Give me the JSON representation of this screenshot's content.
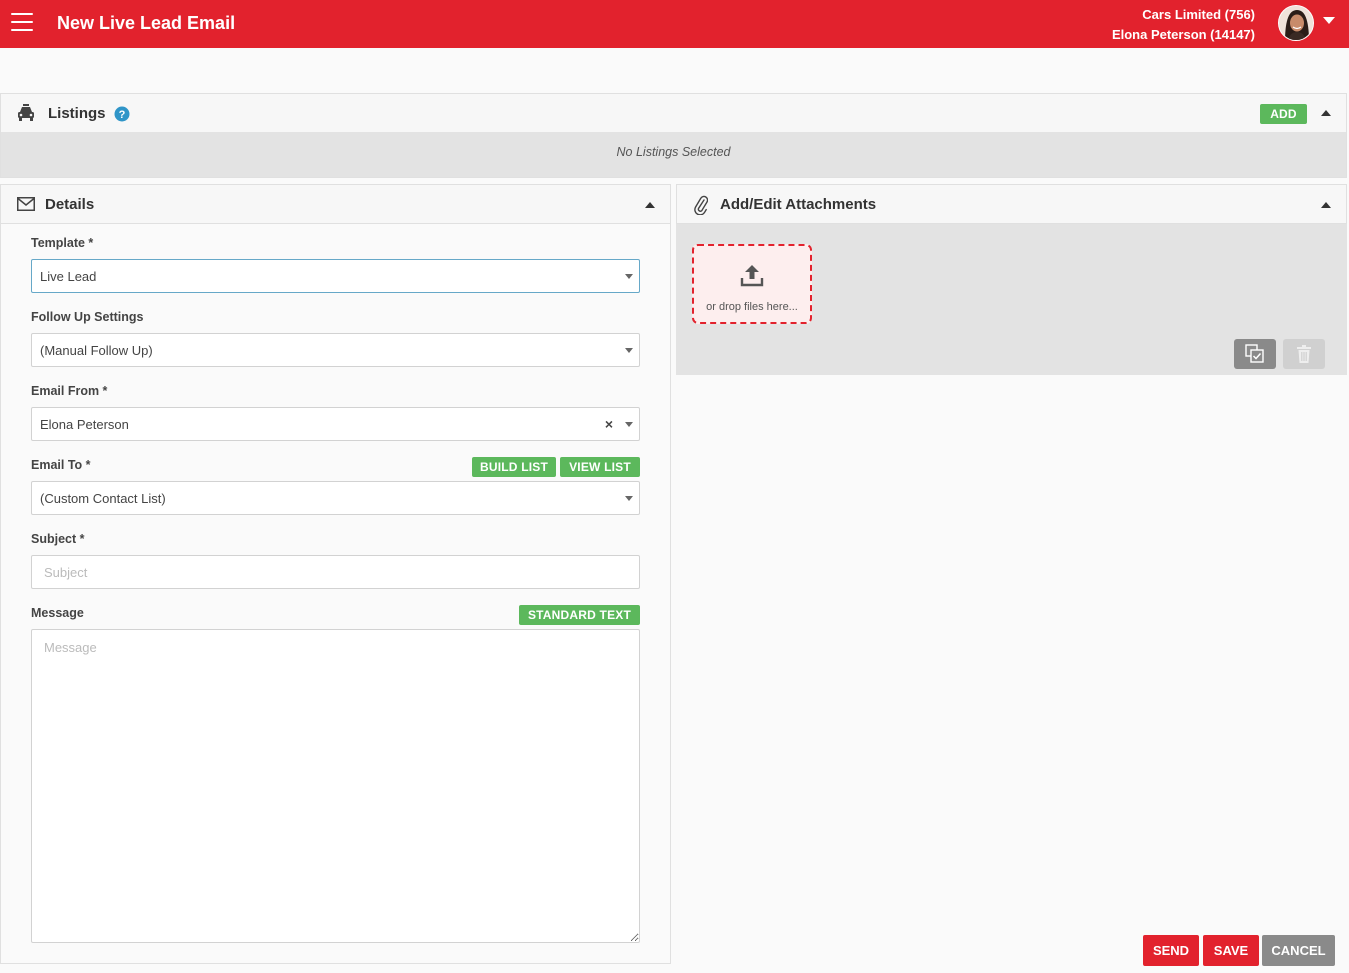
{
  "header": {
    "title": "New Live Lead Email",
    "account_line1": "Cars Limited (756)",
    "account_line2": "Elona Peterson (14147)"
  },
  "listings": {
    "title": "Listings",
    "add_label": "ADD",
    "empty_text": "No Listings Selected"
  },
  "details": {
    "title": "Details",
    "template": {
      "label": "Template *",
      "value": "Live Lead"
    },
    "follow_up": {
      "label": "Follow Up Settings",
      "value": "(Manual Follow Up)"
    },
    "email_from": {
      "label": "Email From *",
      "value": "Elona Peterson",
      "clear": "×"
    },
    "email_to": {
      "label": "Email To *",
      "value": "(Custom Contact List)",
      "build_list": "BUILD LIST",
      "view_list": "VIEW LIST"
    },
    "subject": {
      "label": "Subject *",
      "placeholder": "Subject"
    },
    "message": {
      "label": "Message",
      "placeholder": "Message",
      "standard_text": "STANDARD TEXT"
    }
  },
  "attachments": {
    "title": "Add/Edit Attachments",
    "drop_text": "or drop files here..."
  },
  "actions": {
    "send": "SEND",
    "save": "SAVE",
    "cancel": "CANCEL"
  },
  "colors": {
    "brand_red": "#e2222d",
    "success_green": "#5cb85c",
    "neutral_grey": "#8a8a8a"
  }
}
